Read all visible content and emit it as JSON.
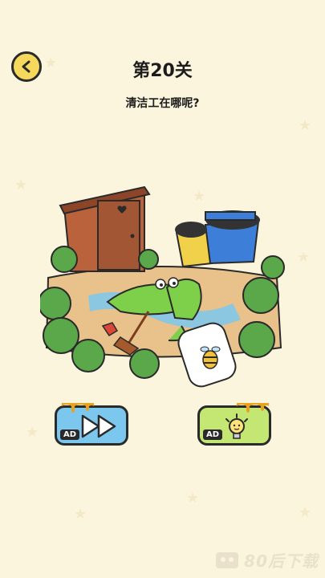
{
  "header": {
    "level_title": "第20关",
    "question": "清洁工在哪呢?"
  },
  "icons": {
    "back": "back-arrow-icon",
    "skip": "fast-forward-icon",
    "hint": "lightbulb-icon",
    "sticker": "bee-icon"
  },
  "buttons": {
    "skip_ad_tag": "AD",
    "hint_ad_tag": "AD"
  },
  "watermark": {
    "text": "80后下载"
  },
  "colors": {
    "background": "#fbf5dd",
    "back_button": "#f6d95c",
    "skip_button": "#7cc7ee",
    "hint_button": "#c4e773",
    "honey": "#e8a21c"
  }
}
